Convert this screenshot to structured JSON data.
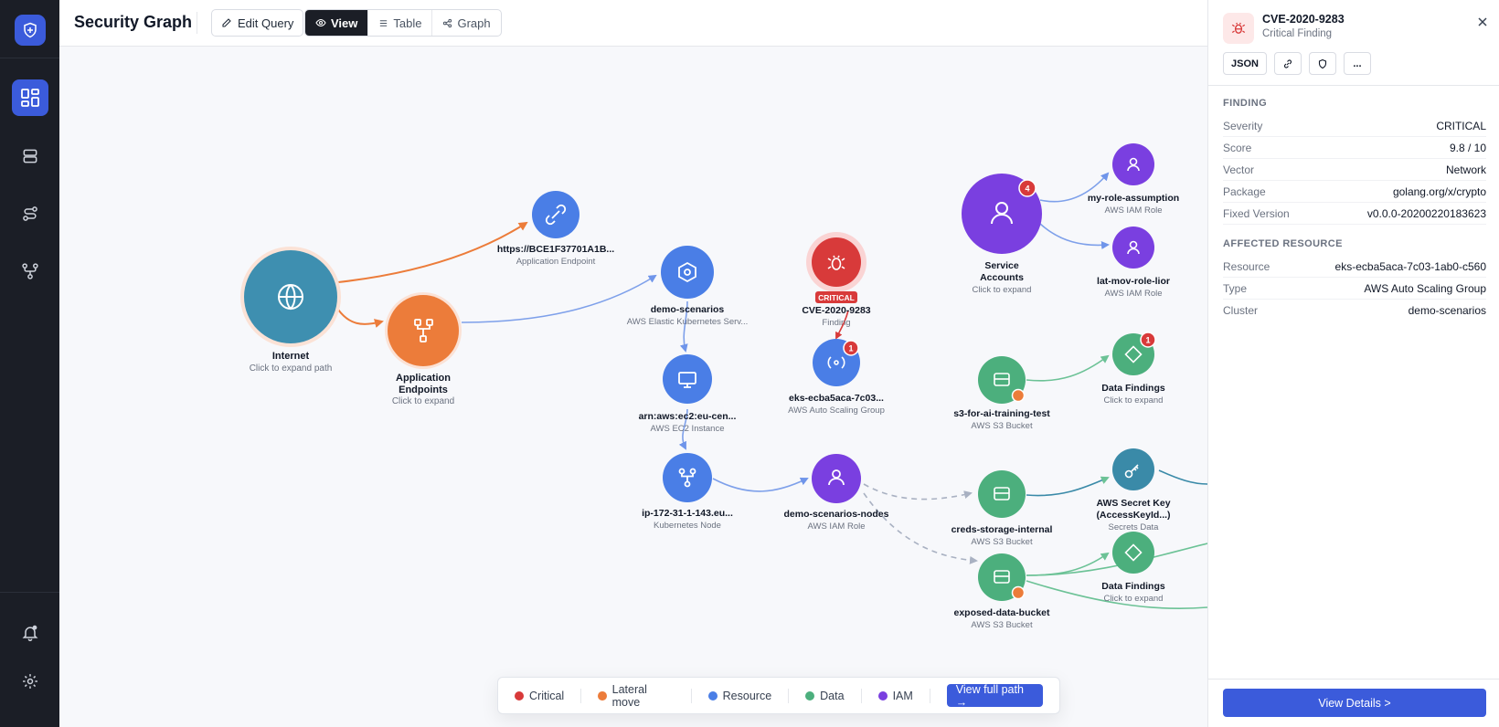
{
  "header": {
    "title": "Security Graph",
    "edit_query": "Edit Query",
    "view": "View",
    "table": "Table",
    "graph": "Graph"
  },
  "graph": {
    "nodes": {
      "internet": {
        "label": "Internet",
        "sub": "Click to expand path"
      },
      "app_endpoints": {
        "label": "Application",
        "label2": "Endpoints",
        "sub": "Click to expand"
      },
      "url": {
        "label": "https://BCE1F37701A1B...",
        "sub": "Application Endpoint"
      },
      "demo_scenarios": {
        "label": "demo-scenarios",
        "sub": "AWS Elastic Kubernetes Serv..."
      },
      "ec2": {
        "label": "arn:aws:ec2:eu-cen...",
        "sub": "AWS EC2 Instance"
      },
      "k8s_node": {
        "label": "ip-172-31-1-143.eu...",
        "sub": "Kubernetes Node"
      },
      "cve": {
        "label": "CVE-2020-9283",
        "sub": "Finding",
        "badge": "CRITICAL"
      },
      "eks_asg": {
        "label": "eks-ecba5aca-7c03...",
        "sub": "AWS Auto Scaling Group",
        "count": "1"
      },
      "nodes_role": {
        "label": "demo-scenarios-nodes",
        "sub": "AWS IAM Role"
      },
      "service_accounts": {
        "label": "Service",
        "label2": "Accounts",
        "sub": "Click to expand",
        "count": "4"
      },
      "my_role": {
        "label": "my-role-assumption",
        "sub": "AWS IAM Role"
      },
      "lat_mov": {
        "label": "lat-mov-role-lior",
        "sub": "AWS IAM Role"
      },
      "s3_ai": {
        "label": "s3-for-ai-training-test",
        "sub": "AWS S3 Bucket"
      },
      "data_findings_1": {
        "label": "Data Findings",
        "sub": "Click to expand",
        "count": "1"
      },
      "creds": {
        "label": "creds-storage-internal",
        "sub": "AWS S3 Bucket"
      },
      "secret_key": {
        "label": "AWS Secret Key",
        "label2": "(AccessKeyId...)",
        "sub": "Secrets Data"
      },
      "exposed": {
        "label": "exposed-data-bucket",
        "sub": "AWS S3 Bucket"
      },
      "data_findings_2": {
        "label": "Data Findings",
        "sub": "Click to expand"
      }
    }
  },
  "legend": {
    "critical": "Critical",
    "lateral": "Lateral move",
    "resource": "Resource",
    "data": "Data",
    "iam": "IAM",
    "button": "View full path →"
  },
  "panel": {
    "title": "CVE-2020-9283",
    "subtitle": "Critical Finding",
    "json_btn": "JSON",
    "more_btn": "...",
    "finding_header": "FINDING",
    "finding": [
      {
        "k": "Severity",
        "v": "CRITICAL"
      },
      {
        "k": "Score",
        "v": "9.8 / 10"
      },
      {
        "k": "Vector",
        "v": "Network"
      },
      {
        "k": "Package",
        "v": "golang.org/x/crypto"
      },
      {
        "k": "Fixed Version",
        "v": "v0.0.0-20200220183623"
      }
    ],
    "affected_header": "AFFECTED RESOURCE",
    "affected": [
      {
        "k": "Resource",
        "v": "eks-ecba5aca-7c03-1ab0-c560"
      },
      {
        "k": "Type",
        "v": "AWS Auto Scaling Group"
      },
      {
        "k": "Cluster",
        "v": "demo-scenarios"
      }
    ],
    "details_btn": "View Details >"
  },
  "colors": {
    "critical": "#d83a3a",
    "lateral": "#ec7c3a",
    "resource": "#4a7ee6",
    "data": "#4caf7d",
    "iam": "#7a3fe0",
    "internet": "#3e8fb0",
    "secrets": "#3a8aa8",
    "accent": "#3b5bdb"
  }
}
